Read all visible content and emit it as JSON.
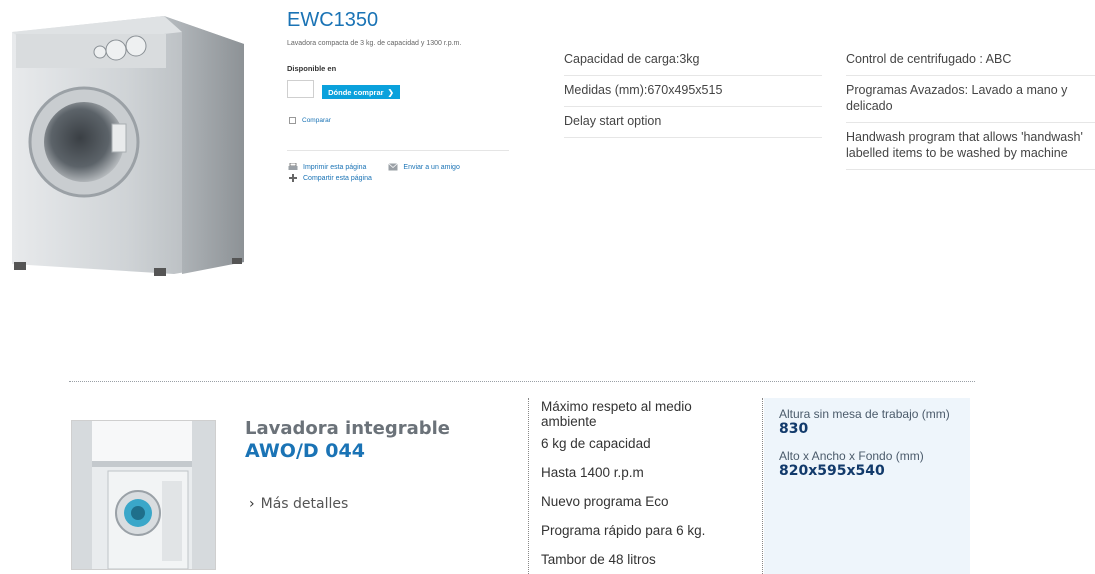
{
  "top_product": {
    "title": "EWC1350",
    "description": "Lavadora compacta de 3 kg. de capacidad y 1300 r.p.m.",
    "availability_label": "Disponible en",
    "buy_button": "Dónde comprar",
    "buy_chevron": "❯",
    "compare_label": "Comparar",
    "actions": {
      "print": "Imprimir esta página",
      "email": "Enviar a un amigo",
      "share": "Compartir esta página"
    },
    "specs_col1": [
      "Capacidad de carga:3kg",
      "Medidas (mm):670x495x515",
      "Delay start option"
    ],
    "specs_col2": [
      "Control de centrifugado : ABC",
      "Programas Avazados: Lavado a mano y delicado",
      "Handwash program that allows 'handwash' labelled items to be washed by machine"
    ]
  },
  "bottom_product": {
    "category": "Lavadora integrable",
    "model": "AWO/D 044",
    "more_details": "Más detalles",
    "more_chevron": "›",
    "features": [
      "Máximo respeto al medio ambiente",
      "6 kg de capacidad",
      "Hasta 1400 r.p.m",
      "Nuevo programa Eco",
      "Programa rápido para 6 kg.",
      "Tambor de 48 litros"
    ],
    "dimensions": [
      {
        "label": "Altura sin mesa de trabajo (mm)",
        "value": "830"
      },
      {
        "label": "Alto x Ancho x Fondo (mm)",
        "value": "820x595x540"
      }
    ]
  },
  "colors": {
    "link_blue": "#1a73b5",
    "button_cyan": "#0aa1dc",
    "dim_value_navy": "#123a6b",
    "dims_panel_bg": "#eef5fb"
  }
}
